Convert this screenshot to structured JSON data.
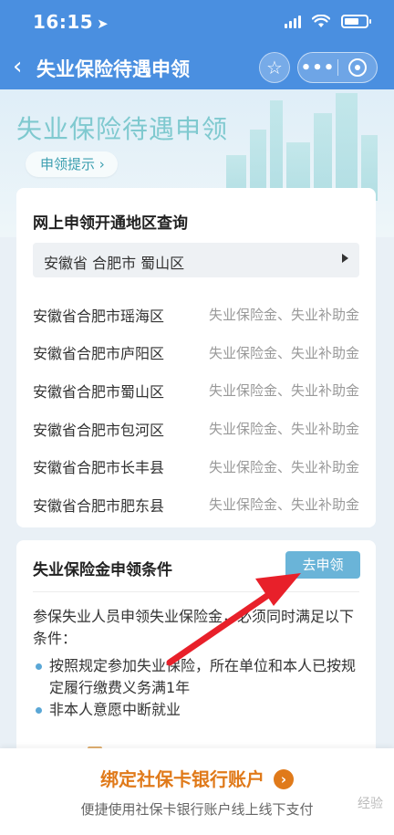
{
  "status_bar": {
    "time": "16:15",
    "location_icon": "location-arrow-icon",
    "battery_level": 0.7
  },
  "nav": {
    "title": "失业保险待遇申领",
    "back_icon": "chevron-left-icon",
    "star_icon": "star-icon",
    "more_label": "•••",
    "close_icon": "target-circle-icon"
  },
  "banner": {
    "title": "失业保险待遇申领",
    "tip_label": "申领提示 ›"
  },
  "region_card": {
    "title": "网上申领开通地区查询",
    "selected_region": "安徽省  合肥市  蜀山区",
    "rows": [
      {
        "name": "安徽省合肥市瑶海区",
        "type": "失业保险金、失业补助金"
      },
      {
        "name": "安徽省合肥市庐阳区",
        "type": "失业保险金、失业补助金"
      },
      {
        "name": "安徽省合肥市蜀山区",
        "type": "失业保险金、失业补助金"
      },
      {
        "name": "安徽省合肥市包河区",
        "type": "失业保险金、失业补助金"
      },
      {
        "name": "安徽省合肥市长丰县",
        "type": "失业保险金、失业补助金"
      },
      {
        "name": "安徽省合肥市肥东县",
        "type": "失业保险金、失业补助金"
      }
    ]
  },
  "conditions_card": {
    "title": "失业保险金申领条件",
    "apply_label": "去申领",
    "intro": "参保失业人员申领失业保险金，必须同时满足以下条件：",
    "items": [
      "按照规定参加失业保险，所在单位和本人已按规定履行缴费义务满1年",
      "非本人意愿中断就业"
    ]
  },
  "bottom_bar": {
    "title": "绑定社保卡银行账户",
    "go_label": "›",
    "subtitle": "便捷使用社保卡银行账户线上线下支付"
  },
  "watermark": "经验",
  "colors": {
    "nav_blue": "#4a8fe0",
    "teal": "#7fc9cf",
    "orange": "#e07a1a",
    "button_blue": "#6ab4d8",
    "arrow_red": "#e8202a"
  }
}
